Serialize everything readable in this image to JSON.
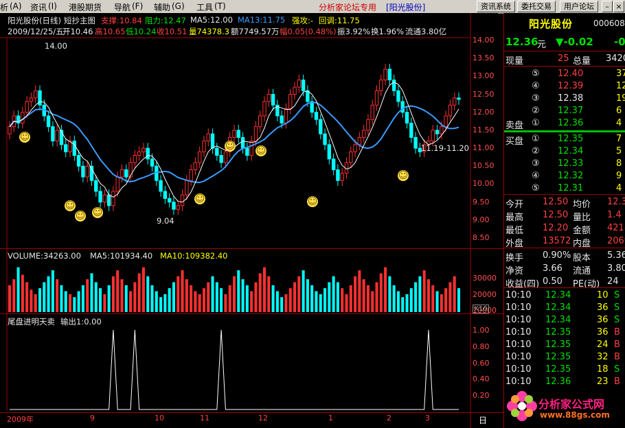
{
  "menu": {
    "items": [
      "析",
      "资讯",
      "港股期货",
      "导航",
      "辅助",
      "工具"
    ],
    "shortcuts": [
      "(A)",
      "(I)",
      "(F)",
      "(G)",
      "(T)"
    ],
    "forum_title": "分析家论坛专用",
    "stock_bracket": "[阳光股份]",
    "buttons": [
      "资讯系统",
      "委托交易",
      "用户论坛"
    ]
  },
  "chart": {
    "name": "阳光股份(日线)",
    "indicator": "短抄主图",
    "support_label": "支撑:10.84",
    "resist_label": "阻力:12.47",
    "ma5_label": "MA5:12.00",
    "ma13_label": "MA13:11.75",
    "strong_label": "强攻:-",
    "pullback_label": "回调:11.75",
    "info_date": "2009/12/25/五",
    "info_open": "开10.46",
    "info_high": "高10.65",
    "info_low": "低10.24",
    "info_close": "收10.51",
    "info_vol": "量74378.3",
    "info_amt": "额7749.57万",
    "info_amp": "幅0.05(0.48%)",
    "info_swing": "振3.92%",
    "info_turn": "换1.96%",
    "info_float": "流通3.80亿",
    "price_axis": [
      "14.00",
      "13.50",
      "13.00",
      "12.50",
      "12.00",
      "11.50",
      "11.00",
      "10.50",
      "10.00",
      "9.50",
      "9.00",
      "8.50"
    ],
    "ann_high": "14.00",
    "ann_low": "9.04",
    "ann_range": "11.19-11.20",
    "colors": {
      "up": "#ff3030",
      "down": "#00ffff",
      "ma5": "#ffffff",
      "ma13": "#3a9cff"
    },
    "price_open": [
      11.4,
      11.6,
      11.9,
      11.7,
      12.0,
      12.3,
      12.4,
      12.6,
      12.2,
      11.9,
      11.6,
      11.2,
      11.5,
      11.1,
      10.9,
      11.2,
      10.8,
      10.5,
      10.2,
      10.5,
      10.1,
      9.8,
      9.5,
      9.7,
      9.4,
      9.8,
      10.2,
      10.4,
      10.2,
      10.6,
      10.8,
      10.9,
      11.0,
      10.7,
      10.5,
      10.1,
      9.8,
      9.6,
      9.5,
      9.3,
      9.4,
      9.7,
      10.1,
      10.4,
      10.6,
      10.9,
      11.2,
      11.4,
      11.0,
      10.8,
      10.6,
      10.9,
      11.3,
      11.5,
      11.3,
      11.0,
      10.8,
      11.2,
      11.6,
      11.9,
      12.3,
      12.5,
      12.2,
      11.9,
      11.7,
      12.1,
      12.5,
      12.7,
      12.9,
      12.6,
      12.3,
      12.0,
      11.8,
      11.4,
      11.1,
      10.7,
      10.4,
      10.1,
      10.3,
      10.6,
      10.9,
      11.1,
      11.3,
      11.5,
      11.8,
      12.2,
      12.6,
      12.9,
      13.2,
      12.9,
      12.6,
      12.3,
      12.0,
      11.7,
      11.3,
      11.0,
      10.9,
      11.1,
      11.2,
      11.5,
      11.4,
      11.6,
      11.9,
      12.2,
      12.4
    ],
    "price_close": [
      11.6,
      11.9,
      11.7,
      12.0,
      12.3,
      12.4,
      12.6,
      12.2,
      11.9,
      11.6,
      11.2,
      11.5,
      11.1,
      10.9,
      11.2,
      10.8,
      10.5,
      10.2,
      10.5,
      10.1,
      9.8,
      9.5,
      9.7,
      9.4,
      9.8,
      10.2,
      10.4,
      10.2,
      10.6,
      10.8,
      10.9,
      11.0,
      10.7,
      10.5,
      10.1,
      9.8,
      9.6,
      9.5,
      9.3,
      9.4,
      9.7,
      10.1,
      10.4,
      10.6,
      10.9,
      11.2,
      11.4,
      11.0,
      10.8,
      10.6,
      10.9,
      11.3,
      11.5,
      11.3,
      11.0,
      10.8,
      11.2,
      11.6,
      11.9,
      12.3,
      12.5,
      12.2,
      11.9,
      11.7,
      12.1,
      12.5,
      12.7,
      12.9,
      12.6,
      12.3,
      12.0,
      11.8,
      11.4,
      11.1,
      10.7,
      10.4,
      10.1,
      10.3,
      10.6,
      10.9,
      11.1,
      11.3,
      11.5,
      11.8,
      12.2,
      12.6,
      12.9,
      13.2,
      12.9,
      12.6,
      12.3,
      12.0,
      11.7,
      11.3,
      11.0,
      10.9,
      11.1,
      11.2,
      11.5,
      11.4,
      11.6,
      11.9,
      12.2,
      12.4,
      12.36
    ],
    "volume_header": {
      "vol": "VOLUME:34263.00",
      "ma5": "MA5:101934.40",
      "ma10": "MA10:109382.40"
    },
    "vol_axis": [
      "30000",
      "20000",
      "10000"
    ],
    "vol_unit": "X10",
    "volumes": [
      18,
      22,
      30,
      25,
      20,
      15,
      12,
      16,
      20,
      24,
      28,
      22,
      18,
      14,
      12,
      10,
      14,
      18,
      22,
      26,
      20,
      16,
      12,
      18,
      24,
      28,
      22,
      18,
      14,
      20,
      26,
      30,
      24,
      18,
      14,
      10,
      12,
      16,
      20,
      24,
      28,
      22,
      18,
      14,
      12,
      16,
      20,
      24,
      20,
      16,
      12,
      18,
      24,
      28,
      22,
      18,
      14,
      20,
      26,
      30,
      24,
      18,
      14,
      10,
      12,
      16,
      20,
      24,
      28,
      22,
      18,
      14,
      12,
      16,
      20,
      24,
      20,
      16,
      12,
      18,
      24,
      28,
      22,
      18,
      14,
      20,
      26,
      30,
      24,
      18,
      14,
      10,
      12,
      16,
      20,
      24,
      28,
      22,
      18,
      14,
      12,
      16,
      20,
      24,
      16
    ],
    "signal_header": {
      "name": "尾盘进明天卖",
      "out": "输出1:0.00"
    },
    "signal_axis": [
      "1.00",
      "0.80",
      "0.60",
      "0.40",
      "0.20"
    ],
    "signal_points": [
      24,
      29,
      49,
      97,
      121
    ],
    "date_axis": [
      "2009年",
      "9",
      "10",
      "11",
      "12",
      "1",
      "2",
      "3"
    ],
    "tab_label": "日"
  },
  "panel": {
    "stock_name": "阳光股份",
    "stock_code": "000608",
    "price": "12.36",
    "unit": "元",
    "change": "▼-0.02",
    "change_pct": "-0.",
    "now_vol_label": "现量",
    "now_vol": "25",
    "total_label": "总量",
    "total_val": "3420",
    "asks": [
      {
        "n": "⑤",
        "p": "12.40",
        "v": "37"
      },
      {
        "n": "④",
        "p": "12.39",
        "v": "12"
      },
      {
        "n": "③",
        "p": "12.38",
        "v": "19"
      },
      {
        "n": "②",
        "p": "12.37",
        "v": "6"
      },
      {
        "n": "①",
        "p": "12.36",
        "v": "4"
      }
    ],
    "ask_label": "卖盘",
    "bid_label": "买盘",
    "bids": [
      {
        "n": "①",
        "p": "12.35",
        "v": "7"
      },
      {
        "n": "②",
        "p": "12.34",
        "v": "5"
      },
      {
        "n": "③",
        "p": "12.33",
        "v": "8"
      },
      {
        "n": "④",
        "p": "12.32",
        "v": "9"
      },
      {
        "n": "⑤",
        "p": "12.31",
        "v": "4"
      }
    ],
    "stats": [
      {
        "l1": "今开",
        "v1": "12.50",
        "l2": "均价",
        "v2": "12.3"
      },
      {
        "l1": "最高",
        "v1": "12.50",
        "l2": "量比",
        "v2": "1.4"
      },
      {
        "l1": "最低",
        "v1": "12.20",
        "l2": "金额",
        "v2": "4218"
      },
      {
        "l1": "外盘",
        "v1": "13572",
        "l2": "内盘",
        "v2": "2069"
      }
    ],
    "stats2": [
      {
        "l1": "换手",
        "v1": "0.90%",
        "l2": "股本",
        "v2": "5.36"
      },
      {
        "l1": "净资",
        "v1": "3.66",
        "l2": "流通",
        "v2": "3.80"
      },
      {
        "l1": "收益(四)",
        "v1": "0.50",
        "l2": "PE(动)",
        "v2": "24"
      }
    ],
    "ticks": [
      {
        "t": "10:10",
        "p": "12.34",
        "v": "10",
        "s": "S"
      },
      {
        "t": "10:10",
        "p": "12.34",
        "v": "36",
        "s": "S"
      },
      {
        "t": "10:10",
        "p": "12.34",
        "v": "36",
        "s": "S"
      },
      {
        "t": "10:10",
        "p": "12.35",
        "v": "36",
        "s": "B"
      },
      {
        "t": "10:10",
        "p": "12.35",
        "v": "24",
        "s": "B"
      },
      {
        "t": "10:10",
        "p": "12.35",
        "v": "32",
        "s": "B"
      },
      {
        "t": "10:10",
        "p": "12.35",
        "v": "18",
        "s": "S"
      },
      {
        "t": "10:10",
        "p": "12.36",
        "v": "23",
        "s": "B"
      }
    ],
    "logo_text": "分析家公式网",
    "logo_url": "www.88gs.com"
  }
}
